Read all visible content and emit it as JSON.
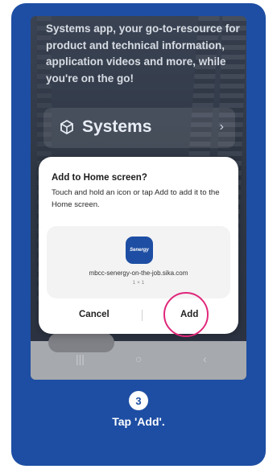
{
  "colors": {
    "card": "#1d4ea3",
    "highlight": "#e0277a",
    "dialog": "#ffffff"
  },
  "background": {
    "intro_text": "Systems app, your go-to-resource for product and technical information, application videos and more, while you're on the go!",
    "systems_card": {
      "icon": "systems-cube-icon",
      "label": "Systems",
      "chevron": "›"
    },
    "nav_glyphs": {
      "recent": "|||",
      "home": "○",
      "back": "‹"
    }
  },
  "dialog": {
    "title": "Add to Home screen?",
    "body": "Touch and hold an icon or tap Add to add it to the Home screen.",
    "app_icon_text": "Senergy",
    "app_url": "mbcc-senergy-on-the-job.sika.com",
    "app_size": "1 × 1",
    "cancel_label": "Cancel",
    "add_label": "Add"
  },
  "step": {
    "number": "3",
    "text": "Tap 'Add'."
  }
}
